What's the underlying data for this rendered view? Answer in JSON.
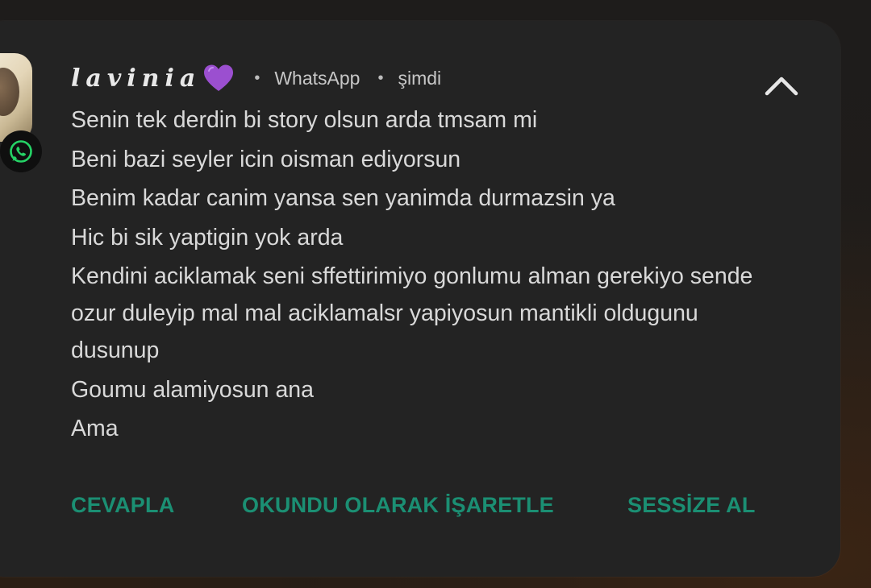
{
  "notification": {
    "sender": "lavinia",
    "sender_emoji": "💜",
    "separator": "•",
    "app_name": "WhatsApp",
    "time": "şimdi",
    "messages": [
      "Senin tek derdin bi story olsun arda tmsam mi",
      "Beni bazi seyler icin oisman ediyorsun",
      "Benim kadar canim yansa sen yanimda durmazsin ya",
      "Hic bi sik yaptigin yok arda",
      "Kendini aciklamak seni sffettirimiyo gonlumu alman gerekiyo sende ozur duleyip mal mal aciklamalsr yapiyosun mantikli oldugunu dusunup",
      "Goumu alamiyosun ana",
      "Ama"
    ],
    "actions": {
      "reply": "CEVAPLA",
      "mark_read": "OKUNDU OLARAK İŞARETLE",
      "mute": "SESSİZE AL"
    }
  },
  "colors": {
    "card_bg": "#232323",
    "text_primary": "#d9d9d9",
    "action_green": "#1b8f73",
    "whatsapp_green": "#25d366",
    "heart_purple": "#9b4fd0"
  },
  "icons": {
    "badge": "whatsapp-icon",
    "expand": "chevron-up-icon",
    "heart": "purple-heart-icon"
  }
}
